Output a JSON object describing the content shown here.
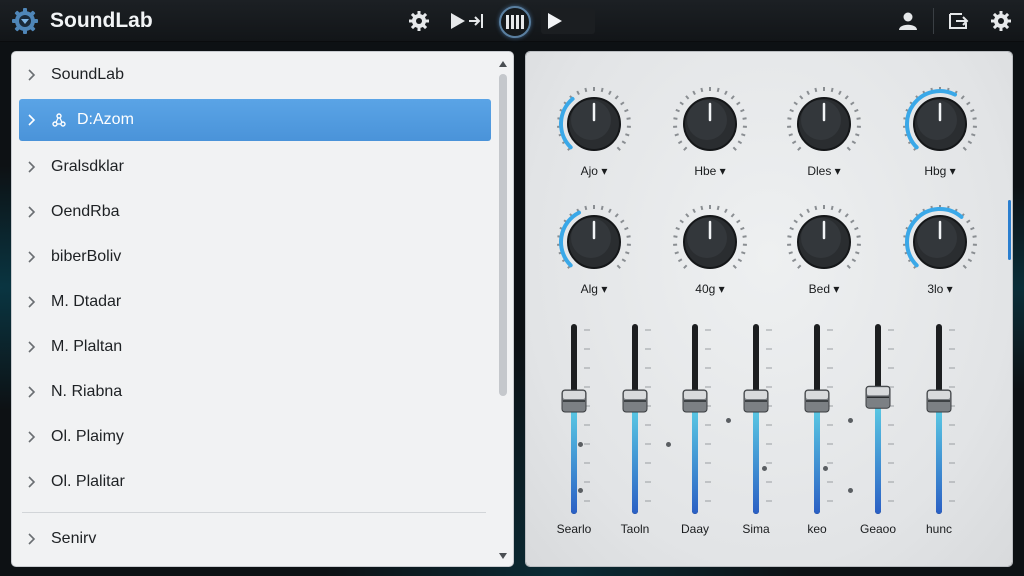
{
  "app": {
    "title": "SoundLab",
    "logo_icon": "gear-logo-icon"
  },
  "toolbar": {
    "icons": [
      "settings-icon",
      "play-step-icon",
      "bars-icon",
      "play-icon",
      "user-icon",
      "export-icon",
      "gear-icon"
    ],
    "accent": "#5a7fa0"
  },
  "list": {
    "items": [
      {
        "label": "SoundLab",
        "selected": false
      },
      {
        "label": "D:Azom",
        "selected": true,
        "icon": "nodes-icon"
      },
      {
        "label": "Gralsdklar",
        "selected": false
      },
      {
        "label": "OendRba",
        "selected": false
      },
      {
        "label": "biberBoliv",
        "selected": false
      },
      {
        "label": "M. Dtadar",
        "selected": false
      },
      {
        "label": "M. Plaltan",
        "selected": false
      },
      {
        "label": "N. Riabna",
        "selected": false
      },
      {
        "label": "Ol. Plaimy",
        "selected": false
      },
      {
        "label": "Ol. Plalitar",
        "selected": false
      },
      {
        "label": "Senirv",
        "selected": false
      }
    ],
    "selected_color": "#4a93d9"
  },
  "knobs": {
    "row1": [
      {
        "label": "Ajo",
        "level": 0.35,
        "glow": true
      },
      {
        "label": "Hbe",
        "level": 0.55,
        "glow": false
      },
      {
        "label": "Dles",
        "level": 0.45,
        "glow": false
      },
      {
        "label": "Hbg",
        "level": 0.6,
        "glow": true
      }
    ],
    "row2": [
      {
        "label": "Alg",
        "level": 0.4,
        "glow": true
      },
      {
        "label": "40g",
        "level": 0.5,
        "glow": false
      },
      {
        "label": "Bed",
        "level": 0.3,
        "glow": false
      },
      {
        "label": "3lo",
        "level": 0.65,
        "glow": true
      }
    ],
    "accent": "#3aa8e8"
  },
  "faders": [
    {
      "label": "Searlo",
      "level": 0.6
    },
    {
      "label": "Taoln",
      "level": 0.6
    },
    {
      "label": "Daay",
      "level": 0.6
    },
    {
      "label": "Sima",
      "level": 0.6
    },
    {
      "label": "keo",
      "level": 0.6
    },
    {
      "label": "Geaoo",
      "level": 0.62
    },
    {
      "label": "hunc",
      "level": 0.6
    }
  ],
  "colors": {
    "fader_top": "#5ed2e6",
    "fader_bottom": "#2a5fc4"
  }
}
